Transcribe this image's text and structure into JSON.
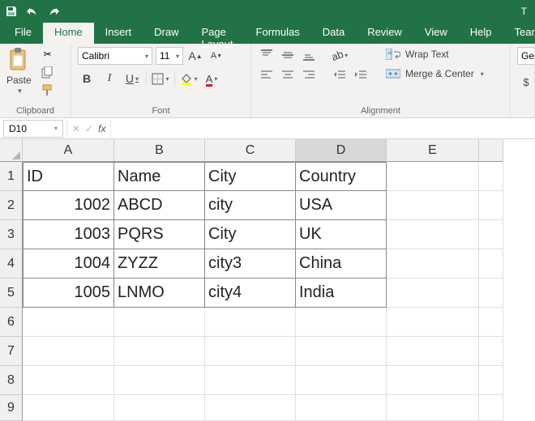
{
  "titlebar": {
    "right": "T"
  },
  "tabs": [
    "File",
    "Home",
    "Insert",
    "Draw",
    "Page Layout",
    "Formulas",
    "Data",
    "Review",
    "View",
    "Help",
    "Team"
  ],
  "active_tab": 1,
  "ribbon": {
    "clipboard": {
      "paste": "Paste",
      "label": "Clipboard"
    },
    "font": {
      "name": "Calibri",
      "size": "11",
      "label": "Font",
      "bold": "B",
      "italic": "I",
      "underline": "U"
    },
    "alignment": {
      "wrap": "Wrap Text",
      "merge": "Merge & Center",
      "label": "Alignment"
    },
    "number": {
      "gen": "Ge",
      "dollar": "$"
    }
  },
  "formula_bar": {
    "name_box": "D10",
    "fx": "fx",
    "value": ""
  },
  "columns": [
    "A",
    "B",
    "C",
    "D",
    "E"
  ],
  "selected_cell": "D10",
  "selected_col": "D",
  "rows_visible": [
    1,
    2,
    3,
    4,
    5,
    6,
    7,
    8,
    9
  ],
  "chart_data": {
    "type": "table",
    "range": "A1:D5",
    "headers": [
      "ID",
      "Name",
      "City",
      "Country"
    ],
    "records": [
      {
        "ID": 1002,
        "Name": "ABCD",
        "City": "city",
        "Country": "USA"
      },
      {
        "ID": 1003,
        "Name": "PQRS",
        "City": "City",
        "Country": "UK"
      },
      {
        "ID": 1004,
        "Name": "ZYZZ",
        "City": "city3",
        "Country": "China"
      },
      {
        "ID": 1005,
        "Name": "LNMO",
        "City": "city4",
        "Country": "India"
      }
    ]
  },
  "cells": {
    "A1": "ID",
    "B1": "Name",
    "C1": "City",
    "D1": "Country",
    "A2": "1002",
    "B2": "ABCD",
    "C2": "city",
    "D2": "USA",
    "A3": "1003",
    "B3": "PQRS",
    "C3": "City",
    "D3": "UK",
    "A4": "1004",
    "B4": "ZYZZ",
    "C4": "city3",
    "D4": "China",
    "A5": "1005",
    "B5": "LNMO",
    "C5": "city4",
    "D5": "India"
  }
}
